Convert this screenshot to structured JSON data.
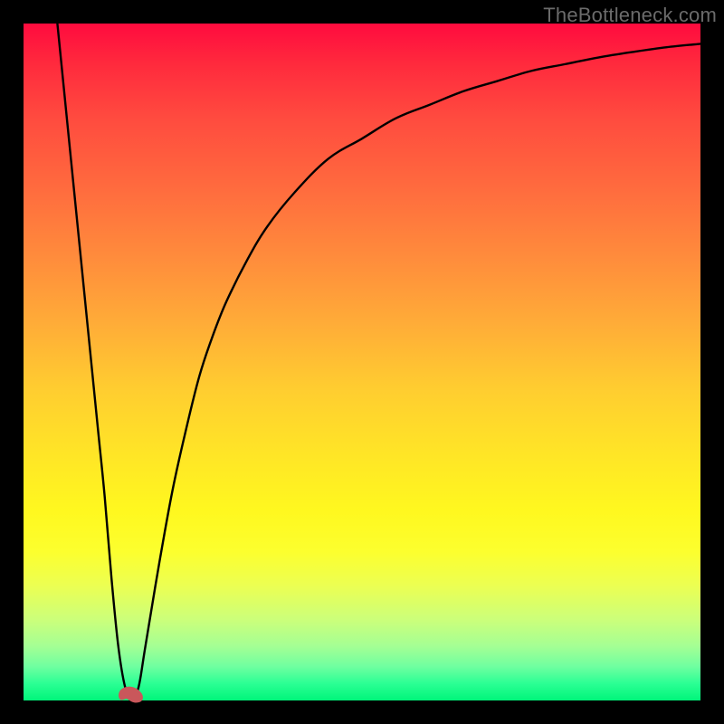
{
  "watermark": "TheBottleneck.com",
  "colors": {
    "ink": "#000000",
    "marker": "#c9575b"
  },
  "chart_data": {
    "type": "line",
    "title": "",
    "xlabel": "",
    "ylabel": "",
    "xlim": [
      0,
      100
    ],
    "ylim": [
      0,
      100
    ],
    "series": [
      {
        "name": "curve",
        "x": [
          5,
          6,
          7,
          8,
          9,
          10,
          11,
          12,
          13,
          14,
          15,
          16,
          17,
          18,
          20,
          22,
          24,
          26,
          28,
          30,
          33,
          36,
          40,
          45,
          50,
          55,
          60,
          65,
          70,
          75,
          80,
          85,
          90,
          95,
          100
        ],
        "y": [
          100,
          90,
          80,
          70,
          60,
          50,
          40,
          30,
          18,
          8,
          2,
          0,
          2,
          8,
          20,
          31,
          40,
          48,
          54,
          59,
          65,
          70,
          75,
          80,
          83,
          86,
          88,
          90,
          91.5,
          93,
          94,
          95,
          95.8,
          96.5,
          97
        ]
      }
    ],
    "marker": {
      "x": 16,
      "y": 0,
      "shape": "bean"
    },
    "grid": false,
    "legend": false
  }
}
